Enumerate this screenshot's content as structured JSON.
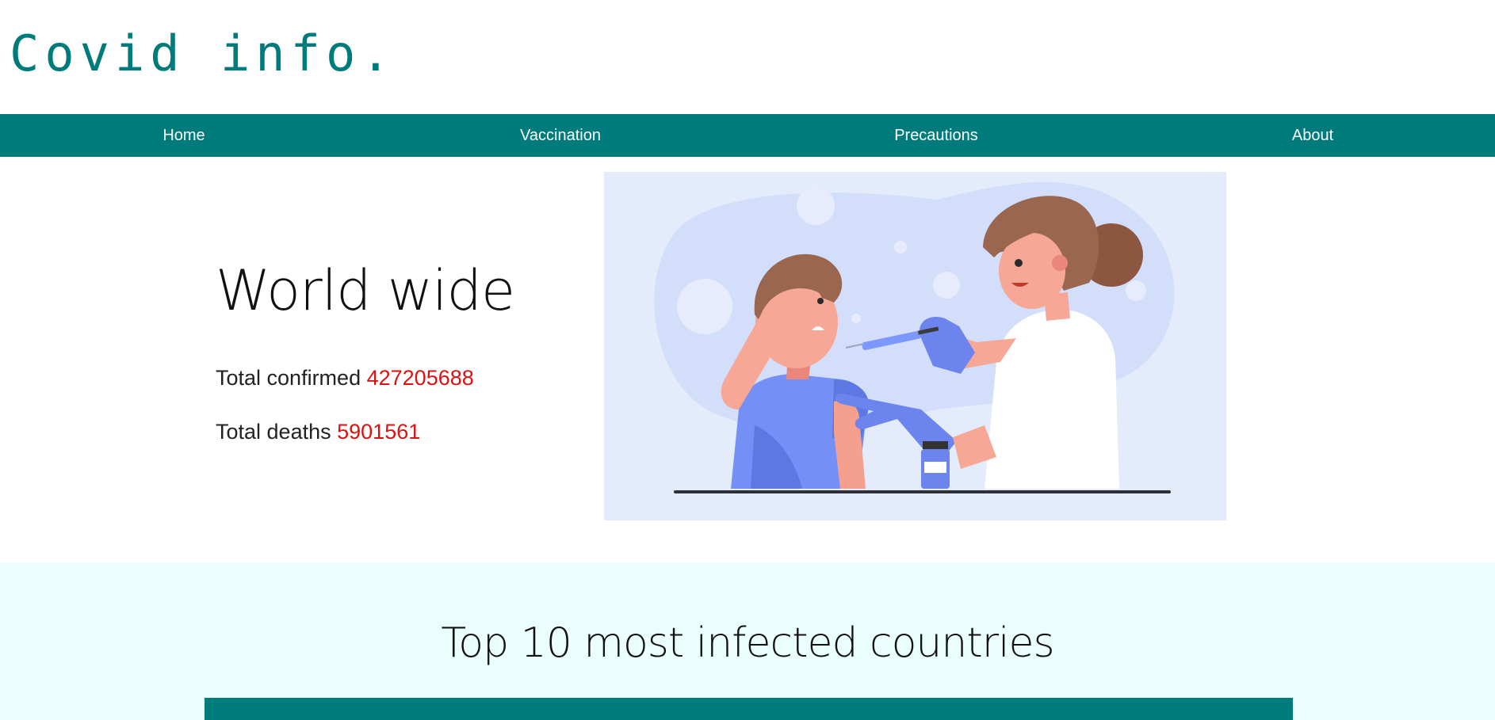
{
  "logo": {
    "text": "Covid info."
  },
  "nav": {
    "items": [
      {
        "label": "Home"
      },
      {
        "label": "Vaccination"
      },
      {
        "label": "Precautions"
      },
      {
        "label": "About"
      }
    ]
  },
  "hero": {
    "title": "World wide",
    "confirmed_label": "Total confirmed",
    "confirmed_value": "427205688",
    "deaths_label": "Total deaths",
    "deaths_value": "5901561",
    "illustration": "vaccination-illustration"
  },
  "top10": {
    "title": "Top 10 most infected countries"
  },
  "colors": {
    "brand": "#007b7b",
    "stat_value": "#dd1111",
    "section_bg": "#ebfefe",
    "illustration_bg": "#e4ebfa"
  }
}
